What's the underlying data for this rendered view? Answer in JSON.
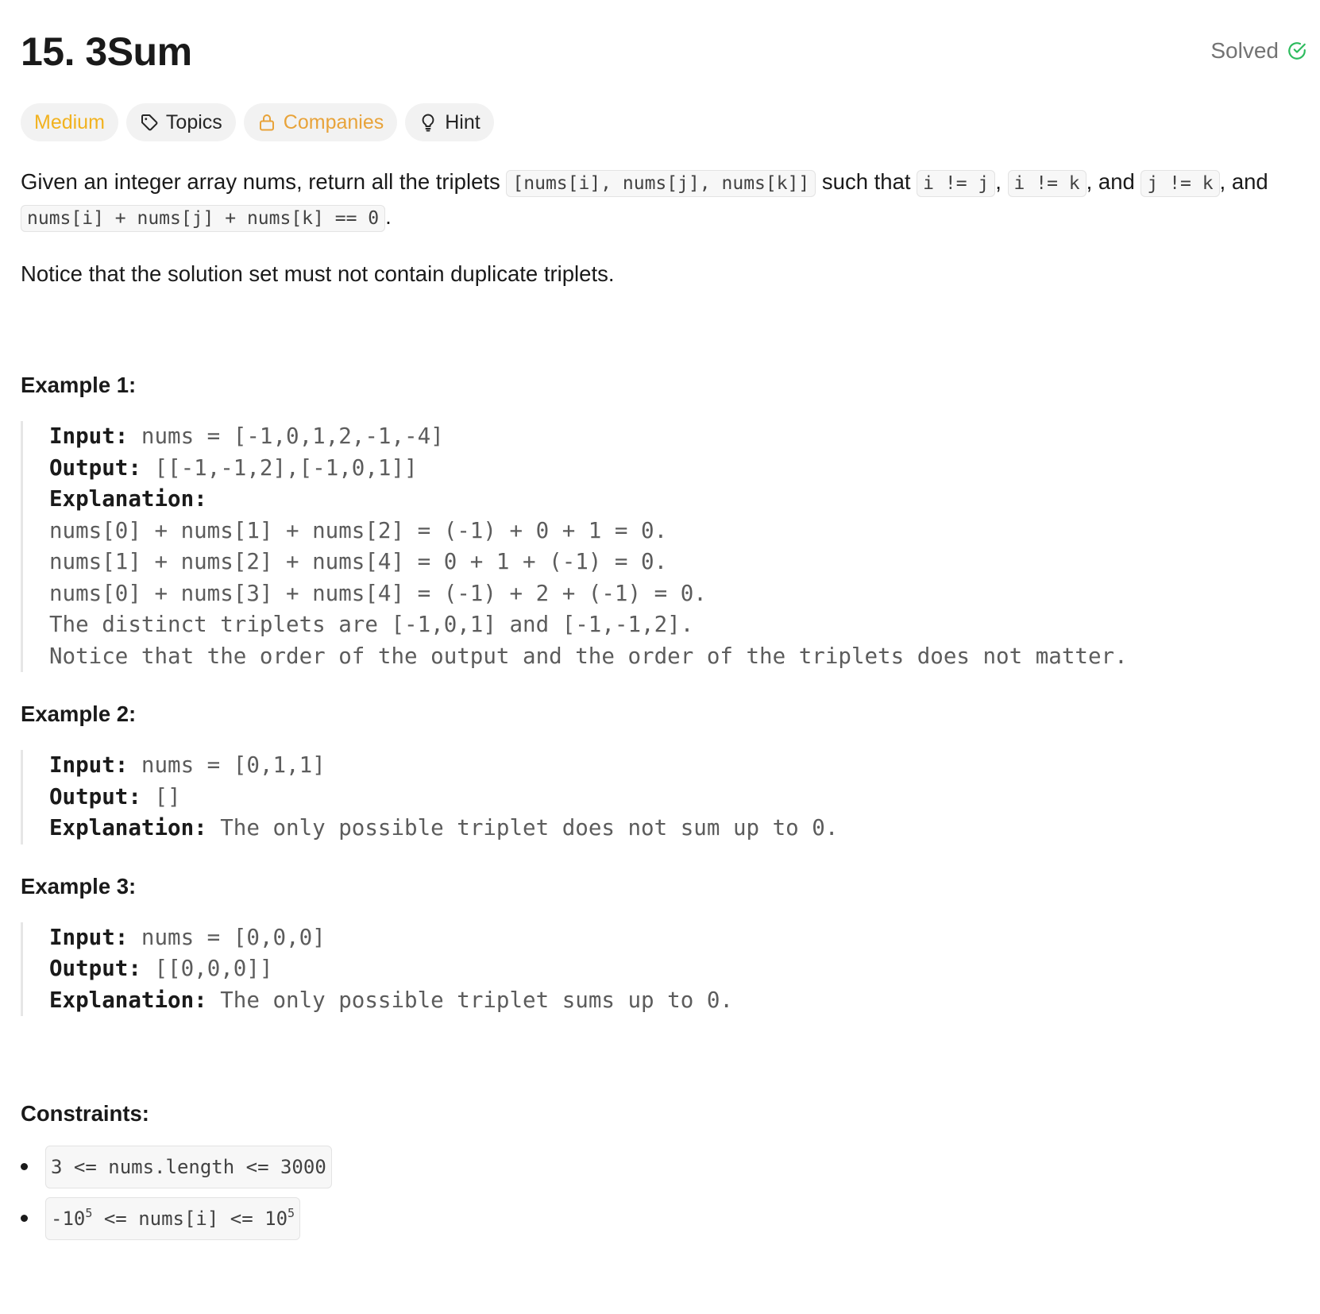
{
  "header": {
    "title": "15. 3Sum",
    "status": "Solved",
    "status_color": "#2cbb5d"
  },
  "tags": {
    "difficulty": "Medium",
    "topics": "Topics",
    "companies": "Companies",
    "hint": "Hint",
    "difficulty_color": "#f2b21f",
    "companies_color": "#e8a33a",
    "icons": [
      "tag-icon",
      "lock-icon",
      "lightbulb-icon"
    ]
  },
  "description": {
    "p1_a": "Given an integer array nums, return all the triplets ",
    "p1_code1": "[nums[i], nums[j], nums[k]]",
    "p1_b": " such that ",
    "p1_code2": "i != j",
    "p1_c": ", ",
    "p1_code3": "i != k",
    "p1_d": ", and ",
    "p1_code4": "j != k",
    "p1_e": ", and ",
    "p1_code5": "nums[i] + nums[j] + nums[k] == 0",
    "p1_f": ".",
    "p2": "Notice that the solution set must not contain duplicate triplets."
  },
  "examples": [
    {
      "title": "Example 1:",
      "input_label": "Input:",
      "input": " nums = [-1,0,1,2,-1,-4]",
      "output_label": "Output:",
      "output": " [[-1,-1,2],[-1,0,1]]",
      "explanation_label": "Explanation:",
      "explanation_lines": [
        "nums[0] + nums[1] + nums[2] = (-1) + 0 + 1 = 0.",
        "nums[1] + nums[2] + nums[4] = 0 + 1 + (-1) = 0.",
        "nums[0] + nums[3] + nums[4] = (-1) + 2 + (-1) = 0.",
        "The distinct triplets are [-1,0,1] and [-1,-1,2].",
        "Notice that the order of the output and the order of the triplets does not matter."
      ]
    },
    {
      "title": "Example 2:",
      "input_label": "Input:",
      "input": " nums = [0,1,1]",
      "output_label": "Output:",
      "output": " []",
      "explanation_label": "Explanation:",
      "explanation": " The only possible triplet does not sum up to 0."
    },
    {
      "title": "Example 3:",
      "input_label": "Input:",
      "input": " nums = [0,0,0]",
      "output_label": "Output:",
      "output": " [[0,0,0]]",
      "explanation_label": "Explanation:",
      "explanation": " The only possible triplet sums up to 0."
    }
  ],
  "constraints": {
    "title": "Constraints:",
    "c1": "3 <= nums.length <= 3000",
    "c2_a": "-10",
    "c2_sup1": "5",
    "c2_b": " <= nums[i] <= 10",
    "c2_sup2": "5"
  }
}
